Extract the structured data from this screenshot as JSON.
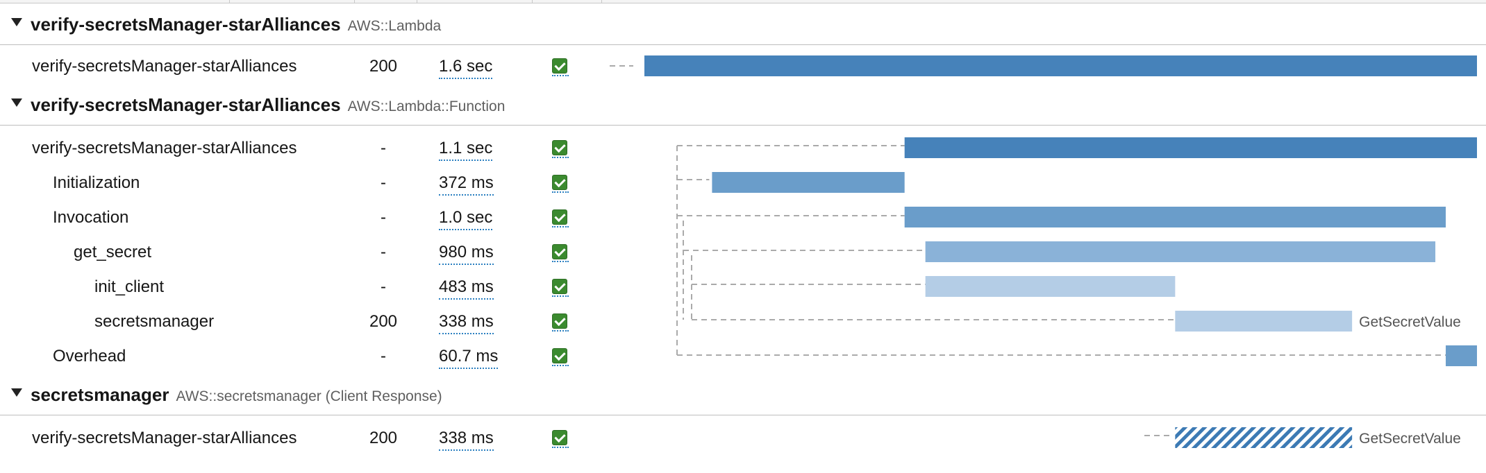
{
  "groups": [
    {
      "title": "verify-secretsManager-starAlliances",
      "type": "AWS::Lambda",
      "rows": [
        {
          "name": "verify-secretsManager-starAlliances",
          "status": "200",
          "duration": "1.6 sec",
          "ok": true
        }
      ]
    },
    {
      "title": "verify-secretsManager-starAlliances",
      "type": "AWS::Lambda::Function",
      "rows": [
        {
          "name": "verify-secretsManager-starAlliances",
          "status": "-",
          "duration": "1.1 sec",
          "ok": true
        },
        {
          "name": "Initialization",
          "status": "-",
          "duration": "372 ms",
          "ok": true
        },
        {
          "name": "Invocation",
          "status": "-",
          "duration": "1.0 sec",
          "ok": true
        },
        {
          "name": "get_secret",
          "status": "-",
          "duration": "980 ms",
          "ok": true
        },
        {
          "name": "init_client",
          "status": "-",
          "duration": "483 ms",
          "ok": true
        },
        {
          "name": "secretsmanager",
          "status": "200",
          "duration": "338 ms",
          "ok": true
        },
        {
          "name": "Overhead",
          "status": "-",
          "duration": "60.7 ms",
          "ok": true
        }
      ]
    },
    {
      "title": "secretsmanager",
      "type": "AWS::secretsmanager (Client Response)",
      "rows": [
        {
          "name": "verify-secretsManager-starAlliances",
          "status": "200",
          "duration": "338 ms",
          "ok": true
        }
      ]
    }
  ],
  "timeline": {
    "total_sec": 1.6,
    "segments": [
      {
        "row": "0.0",
        "start": 0.0,
        "end": 1.6,
        "style": "solid1",
        "label": ""
      },
      {
        "row": "1.0",
        "start": 0.5,
        "end": 1.6,
        "style": "solid1",
        "label": ""
      },
      {
        "row": "1.1",
        "start": 0.13,
        "end": 0.5,
        "style": "solid2",
        "label": ""
      },
      {
        "row": "1.2",
        "start": 0.5,
        "end": 1.54,
        "style": "solid2",
        "label": ""
      },
      {
        "row": "1.3",
        "start": 0.54,
        "end": 1.52,
        "style": "solid3",
        "label": ""
      },
      {
        "row": "1.4",
        "start": 0.54,
        "end": 1.02,
        "style": "solid4",
        "label": ""
      },
      {
        "row": "1.5",
        "start": 1.02,
        "end": 1.36,
        "style": "solid4",
        "label": "GetSecretValue"
      },
      {
        "row": "1.6",
        "start": 1.54,
        "end": 1.6,
        "style": "solid2",
        "label": ""
      },
      {
        "row": "2.0",
        "start": 1.02,
        "end": 1.36,
        "style": "hatched",
        "label": "GetSecretValue"
      }
    ],
    "colors": {
      "solid1": "#4682ba",
      "solid2": "#6a9dca",
      "solid3": "#8ab2d8",
      "solid4": "#b4cde6",
      "hatched": "#3c7ab4",
      "connector": "#aaaaaa"
    }
  }
}
